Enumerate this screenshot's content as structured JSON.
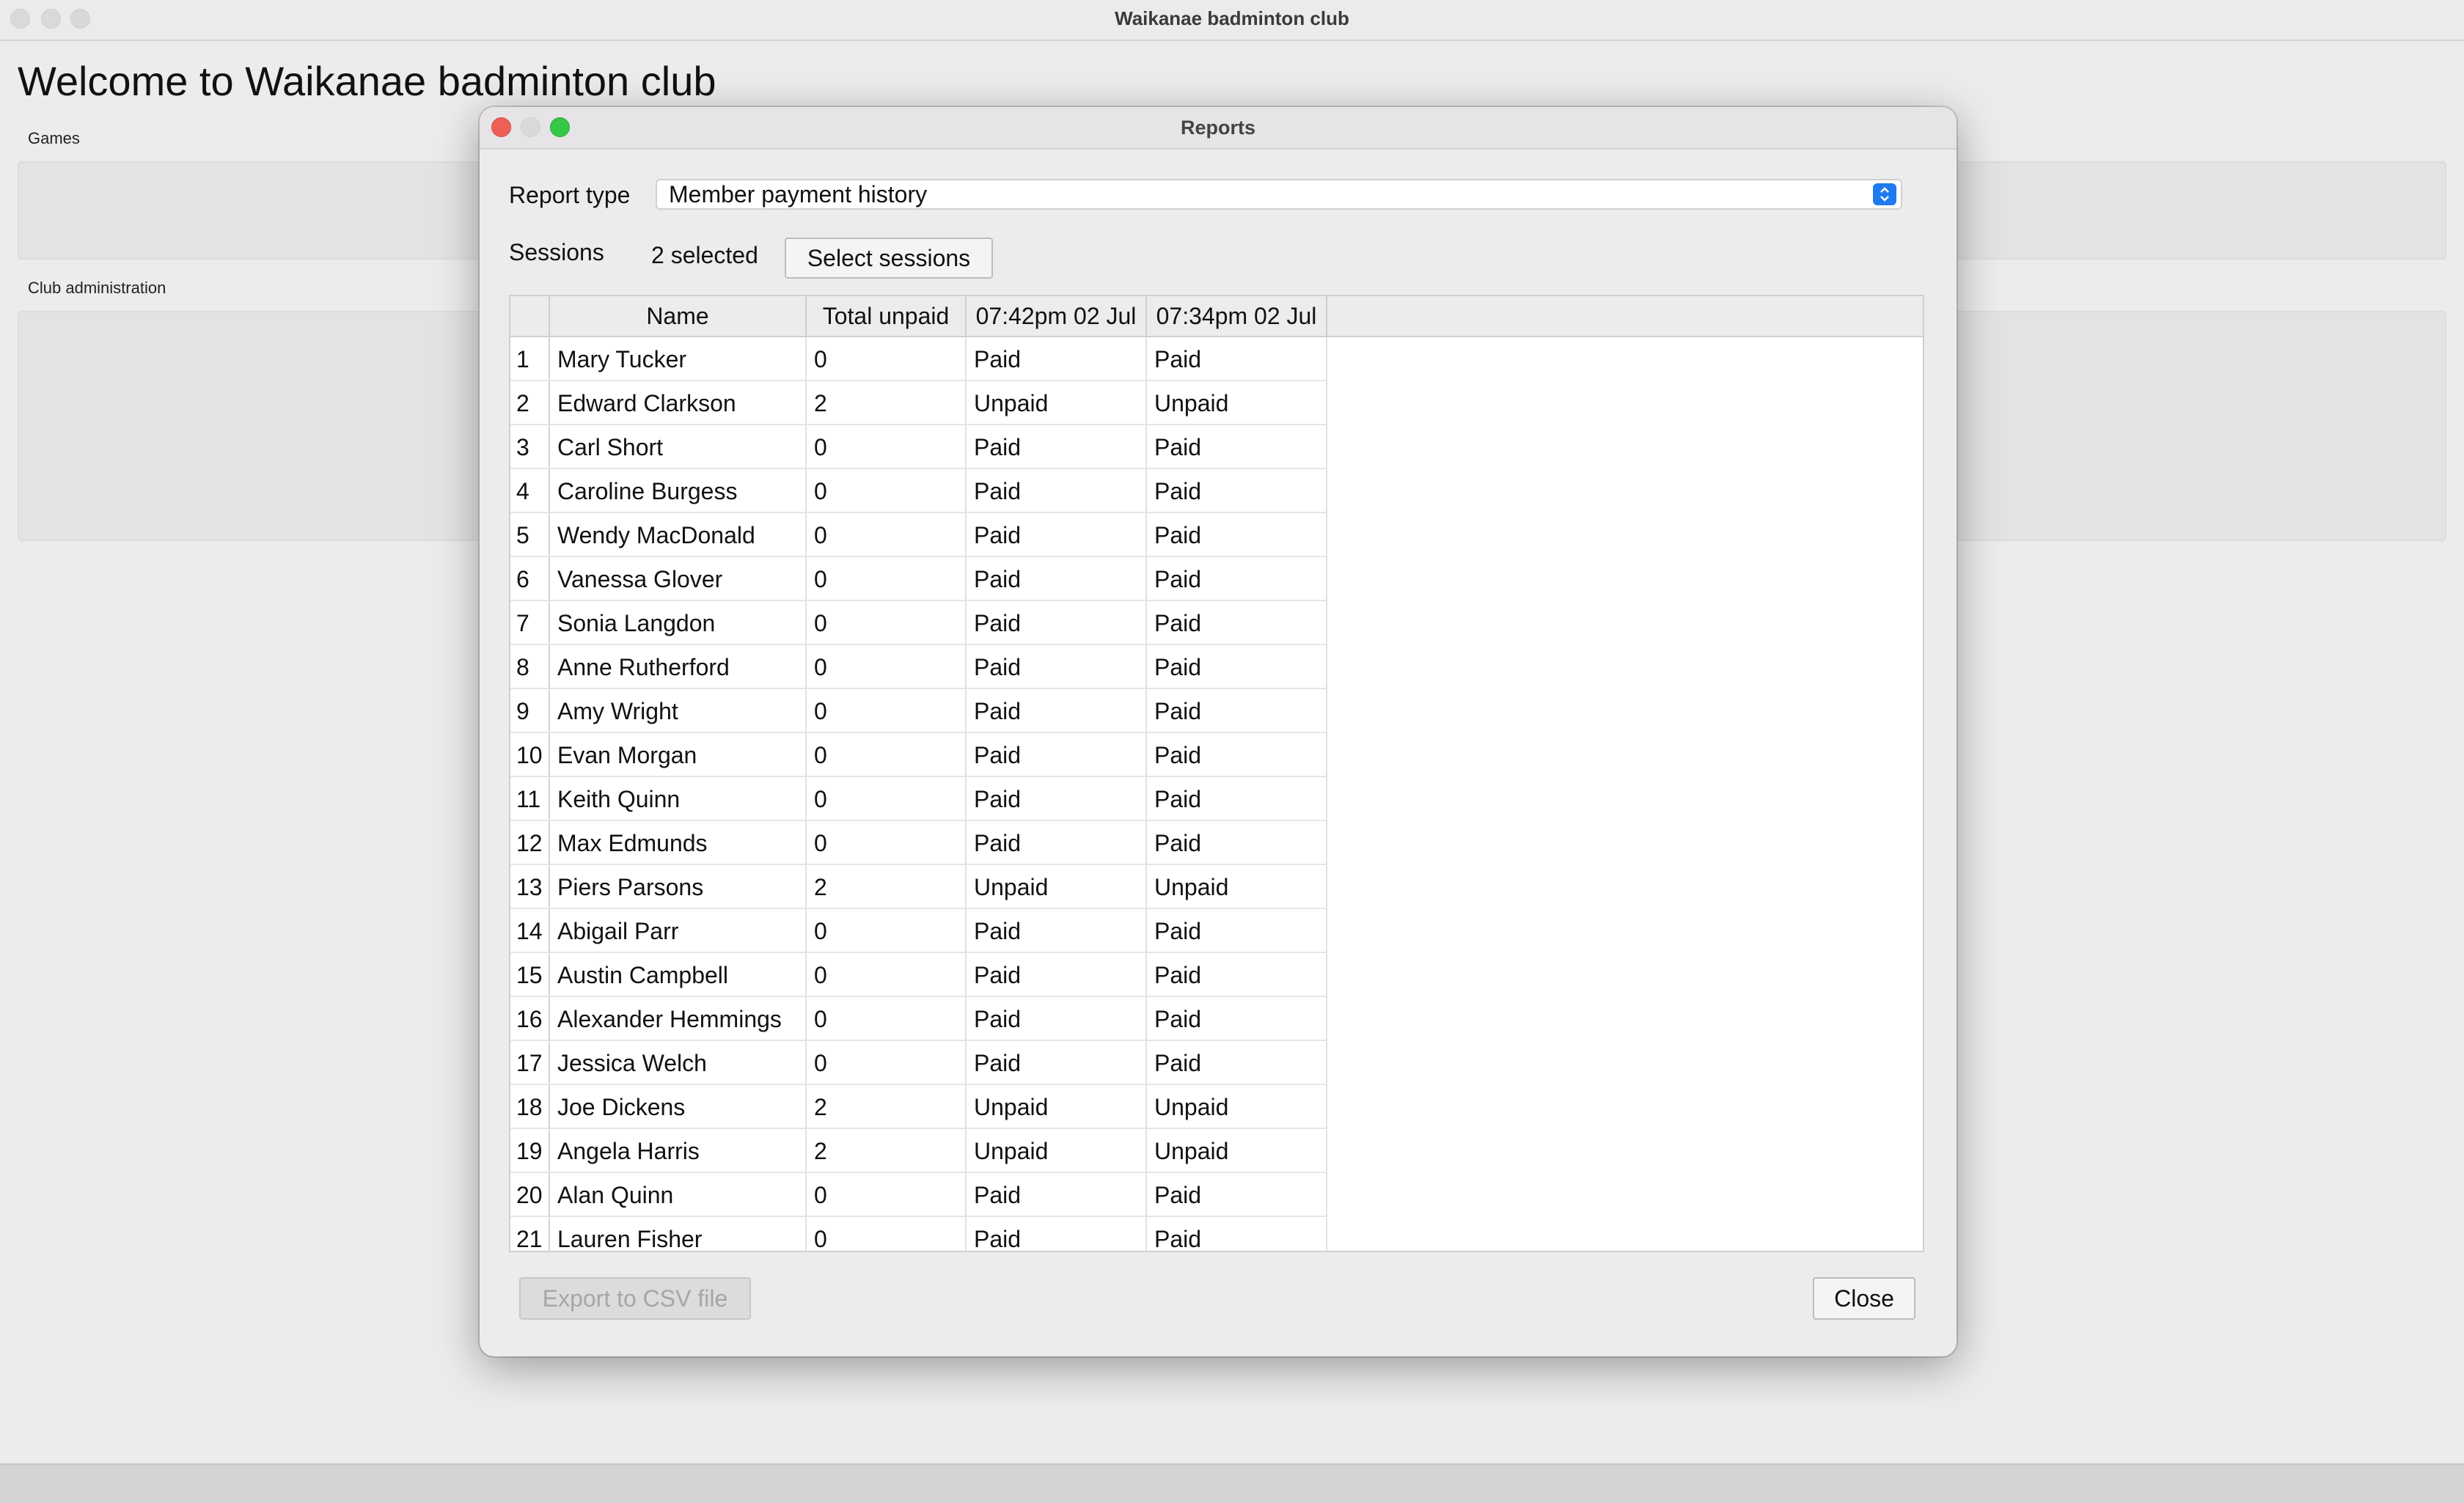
{
  "main_window": {
    "title": "Waikanae badminton club",
    "welcome": "Welcome to Waikanae badminton club",
    "games_label": "Games",
    "club_admin_label": "Club administration"
  },
  "dialog": {
    "title": "Reports",
    "report_type_label": "Report type",
    "report_type_value": "Member payment history",
    "sessions_label": "Sessions",
    "sessions_selected": "2 selected",
    "select_sessions_button": "Select sessions",
    "export_button": "Export to CSV file",
    "close_button": "Close"
  },
  "table": {
    "columns": [
      "Name",
      "Total unpaid",
      "07:42pm 02 Jul",
      "07:34pm 02 Jul"
    ],
    "rows": [
      {
        "idx": "1",
        "name": "Mary Tucker",
        "total": "0",
        "s1": "Paid",
        "s2": "Paid"
      },
      {
        "idx": "2",
        "name": "Edward Clarkson",
        "total": "2",
        "s1": "Unpaid",
        "s2": "Unpaid"
      },
      {
        "idx": "3",
        "name": "Carl Short",
        "total": "0",
        "s1": "Paid",
        "s2": "Paid"
      },
      {
        "idx": "4",
        "name": "Caroline Burgess",
        "total": "0",
        "s1": "Paid",
        "s2": "Paid"
      },
      {
        "idx": "5",
        "name": "Wendy MacDonald",
        "total": "0",
        "s1": "Paid",
        "s2": "Paid"
      },
      {
        "idx": "6",
        "name": "Vanessa Glover",
        "total": "0",
        "s1": "Paid",
        "s2": "Paid"
      },
      {
        "idx": "7",
        "name": "Sonia Langdon",
        "total": "0",
        "s1": "Paid",
        "s2": "Paid"
      },
      {
        "idx": "8",
        "name": "Anne Rutherford",
        "total": "0",
        "s1": "Paid",
        "s2": "Paid"
      },
      {
        "idx": "9",
        "name": "Amy Wright",
        "total": "0",
        "s1": "Paid",
        "s2": "Paid"
      },
      {
        "idx": "10",
        "name": "Evan Morgan",
        "total": "0",
        "s1": "Paid",
        "s2": "Paid"
      },
      {
        "idx": "11",
        "name": "Keith Quinn",
        "total": "0",
        "s1": "Paid",
        "s2": "Paid"
      },
      {
        "idx": "12",
        "name": "Max Edmunds",
        "total": "0",
        "s1": "Paid",
        "s2": "Paid"
      },
      {
        "idx": "13",
        "name": "Piers Parsons",
        "total": "2",
        "s1": "Unpaid",
        "s2": "Unpaid"
      },
      {
        "idx": "14",
        "name": "Abigail Parr",
        "total": "0",
        "s1": "Paid",
        "s2": "Paid"
      },
      {
        "idx": "15",
        "name": "Austin Campbell",
        "total": "0",
        "s1": "Paid",
        "s2": "Paid"
      },
      {
        "idx": "16",
        "name": "Alexander Hemmings",
        "total": "0",
        "s1": "Paid",
        "s2": "Paid"
      },
      {
        "idx": "17",
        "name": "Jessica Welch",
        "total": "0",
        "s1": "Paid",
        "s2": "Paid"
      },
      {
        "idx": "18",
        "name": "Joe Dickens",
        "total": "2",
        "s1": "Unpaid",
        "s2": "Unpaid"
      },
      {
        "idx": "19",
        "name": "Angela Harris",
        "total": "2",
        "s1": "Unpaid",
        "s2": "Unpaid"
      },
      {
        "idx": "20",
        "name": "Alan Quinn",
        "total": "0",
        "s1": "Paid",
        "s2": "Paid"
      },
      {
        "idx": "21",
        "name": "Lauren Fisher",
        "total": "0",
        "s1": "Paid",
        "s2": "Paid"
      }
    ]
  },
  "colors": {
    "close_dot": "#ee5f56",
    "zoom_dot": "#35c748",
    "combo_accent": "#1f7cf0"
  }
}
